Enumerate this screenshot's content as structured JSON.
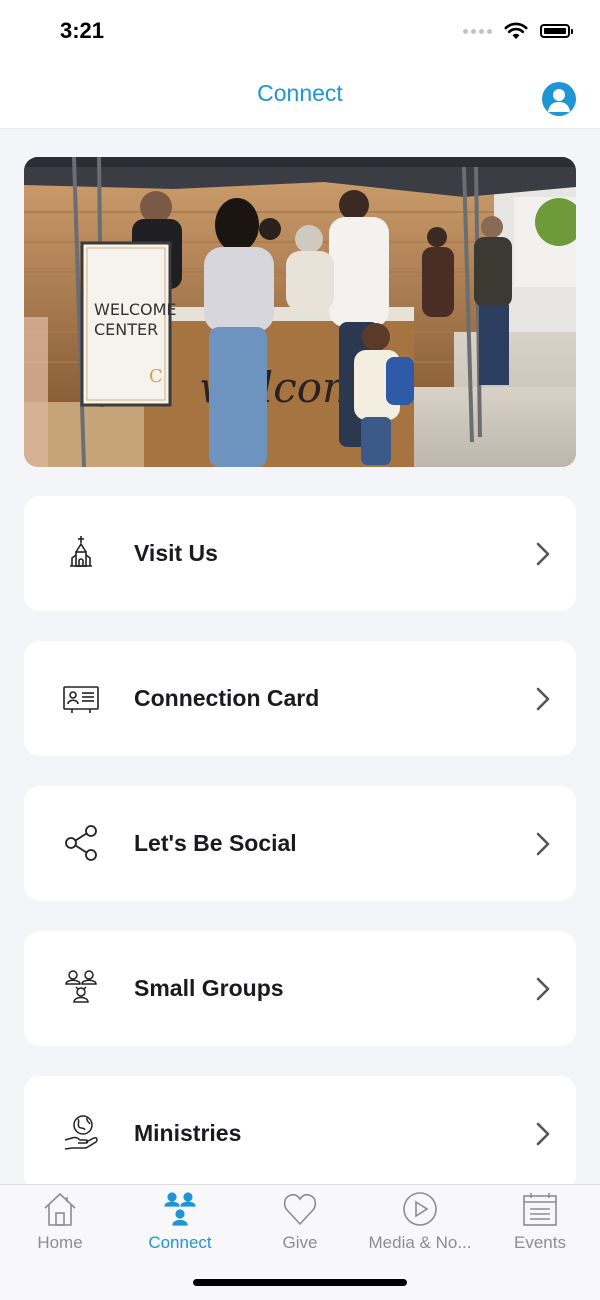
{
  "status_bar": {
    "time": "3:21"
  },
  "header": {
    "title": "Connect"
  },
  "hero": {
    "sign_text": "WELCOME CENTER",
    "sign_line1": "WELCOME",
    "sign_line2": "CENTER",
    "banner_text": "welcome"
  },
  "menu": [
    {
      "label": "Visit Us",
      "icon": "church-icon"
    },
    {
      "label": "Connection Card",
      "icon": "id-card-icon"
    },
    {
      "label": "Let's Be Social",
      "icon": "share-icon"
    },
    {
      "label": "Small Groups",
      "icon": "group-icon"
    },
    {
      "label": "Ministries",
      "icon": "globe-hand-icon"
    }
  ],
  "tabs": [
    {
      "label": "Home",
      "icon": "house-icon",
      "active": false
    },
    {
      "label": "Connect",
      "icon": "people-icon",
      "active": true
    },
    {
      "label": "Give",
      "icon": "heart-icon",
      "active": false
    },
    {
      "label": "Media & No...",
      "icon": "play-icon",
      "active": false
    },
    {
      "label": "Events",
      "icon": "calendar-icon",
      "active": false
    }
  ],
  "colors": {
    "accent": "#1f95d3",
    "background": "#f4f5f9",
    "inactive": "#8c8c92"
  }
}
